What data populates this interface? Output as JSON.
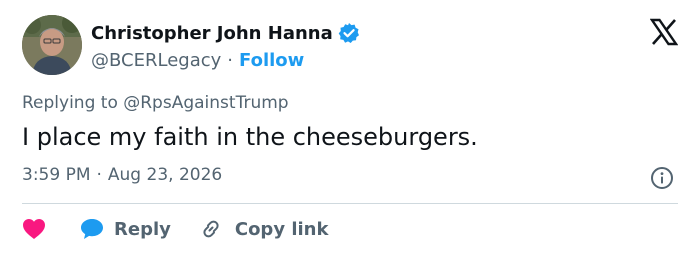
{
  "author": {
    "display_name": "Christopher John Hanna",
    "handle": "@BCERLegacy",
    "separator": "·",
    "follow_label": "Follow",
    "verified": true
  },
  "tweet": {
    "replying_to": "Replying to @RpsAgainstTrump",
    "text": "I place my faith in the cheeseburgers.",
    "time": "3:59 PM",
    "separator": "·",
    "date": "Aug 23, 2026"
  },
  "actions": {
    "reply_label": "Reply",
    "copy_link_label": "Copy link"
  },
  "icons": {
    "verified": "verified-badge-icon",
    "platform": "x-logo-icon",
    "info": "info-icon",
    "like": "heart-icon",
    "reply": "speech-bubble-icon",
    "copy_link": "link-icon"
  },
  "colors": {
    "accent": "#1d9bf0",
    "text": "#0f1419",
    "secondary": "#536471",
    "heart": "#f91880",
    "divider": "#cfd9de"
  }
}
